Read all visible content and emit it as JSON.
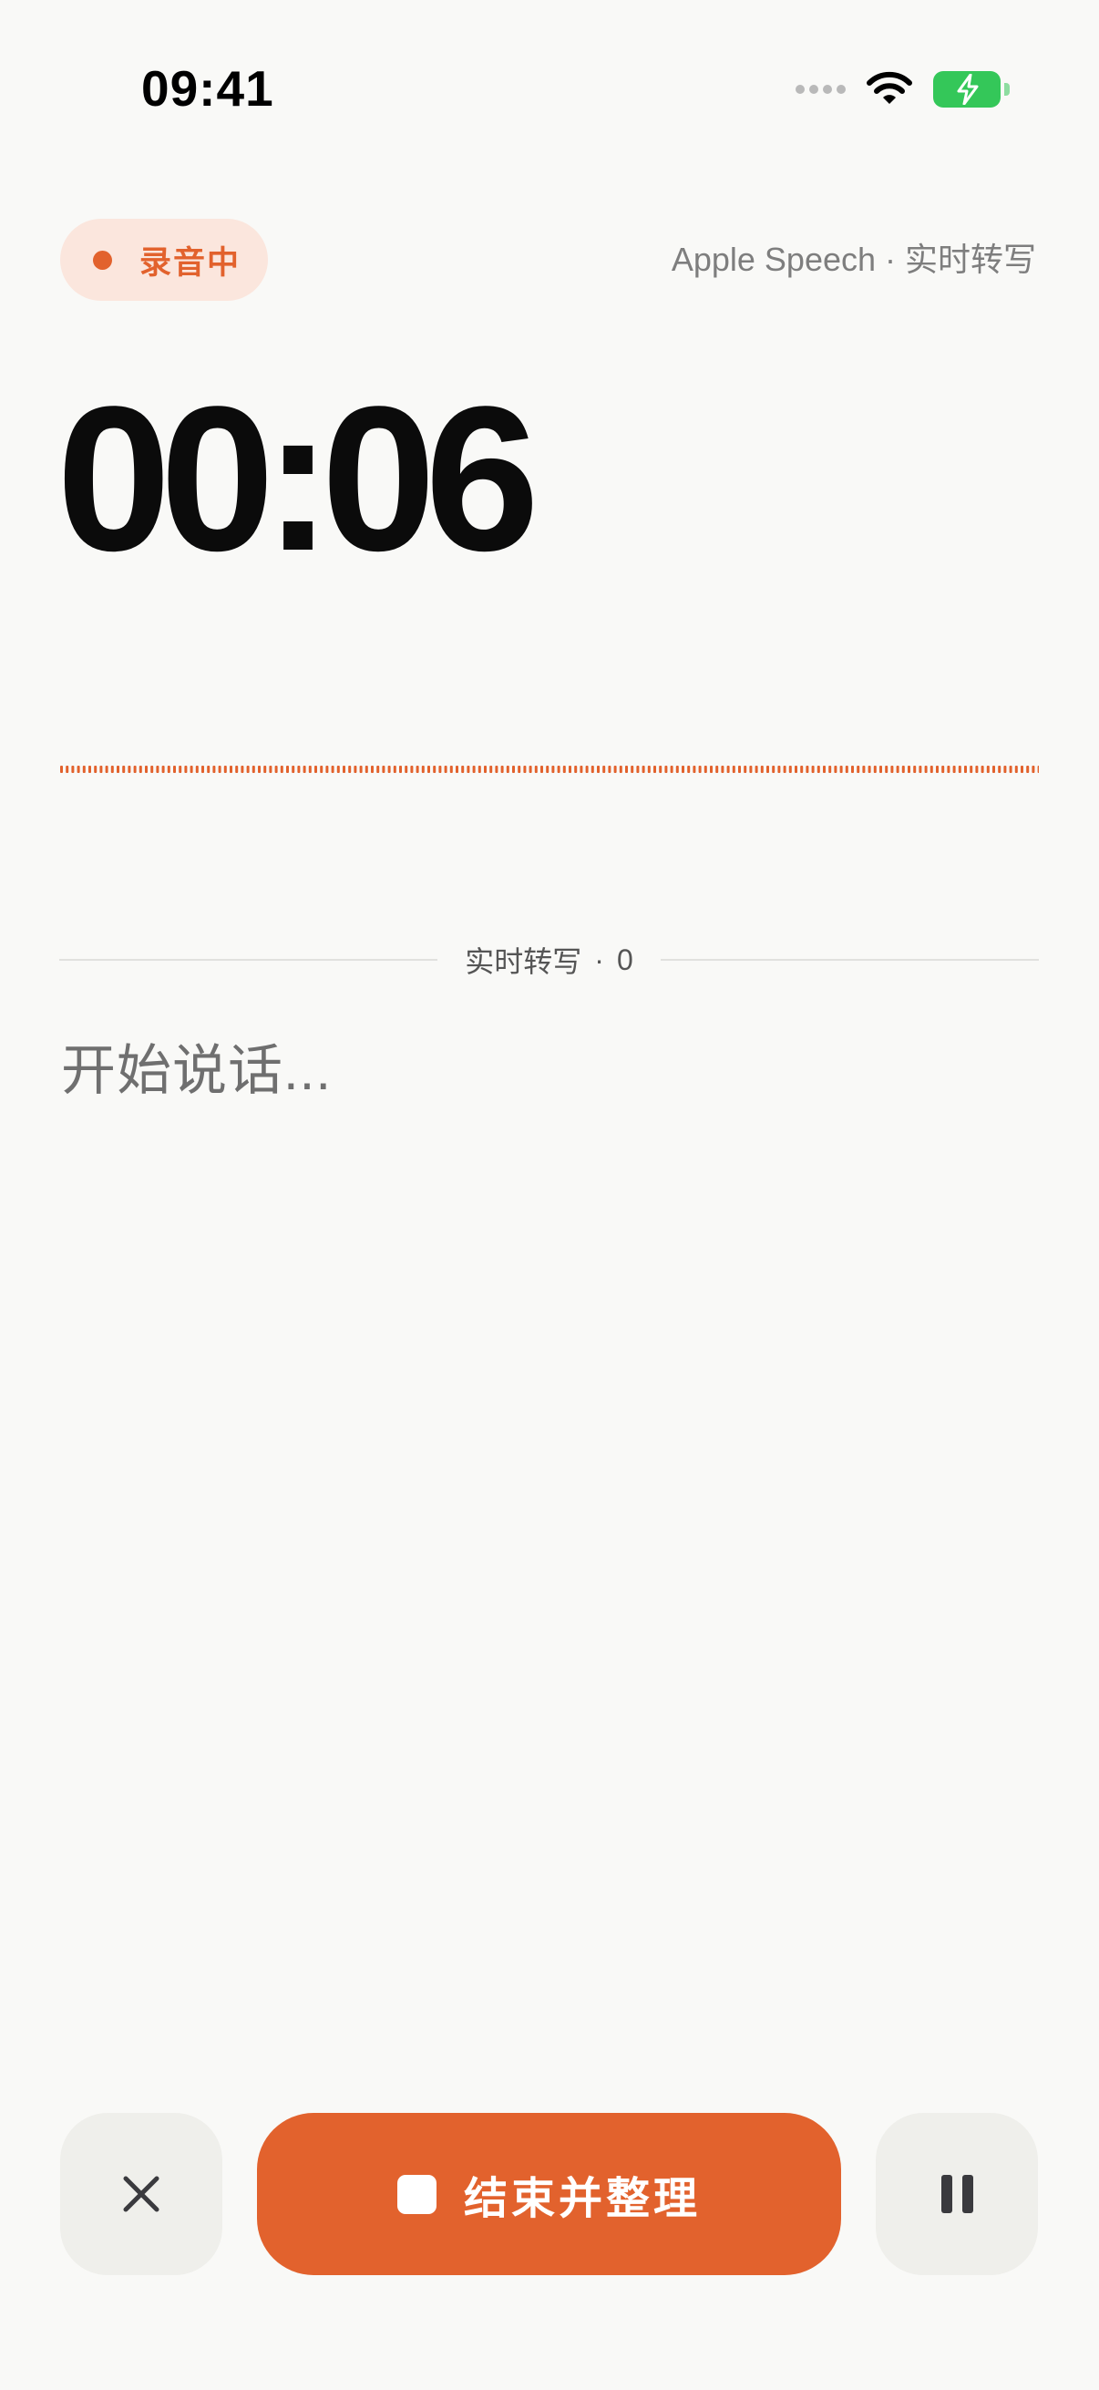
{
  "status_bar": {
    "time": "09:41",
    "icons": [
      "cellular-dots-icon",
      "wifi-icon",
      "battery-charging-icon"
    ],
    "battery_color": "#34c759"
  },
  "recording": {
    "status_label": "录音中",
    "engine_label": "Apple Speech · 实时转写",
    "elapsed": "00:06"
  },
  "waveform": {
    "color": "#e2622d"
  },
  "transcript": {
    "section_title": "实时转写",
    "separator": "·",
    "count": "0",
    "placeholder": "开始说话..."
  },
  "controls": {
    "cancel_icon": "close-icon",
    "finish_label": "结束并整理",
    "finish_icon": "stop-icon",
    "pause_icon": "pause-icon"
  },
  "colors": {
    "accent": "#e2622d",
    "accent_soft": "#fbe6dd",
    "background": "#f9f9f7",
    "control_bg": "#efefeb"
  }
}
